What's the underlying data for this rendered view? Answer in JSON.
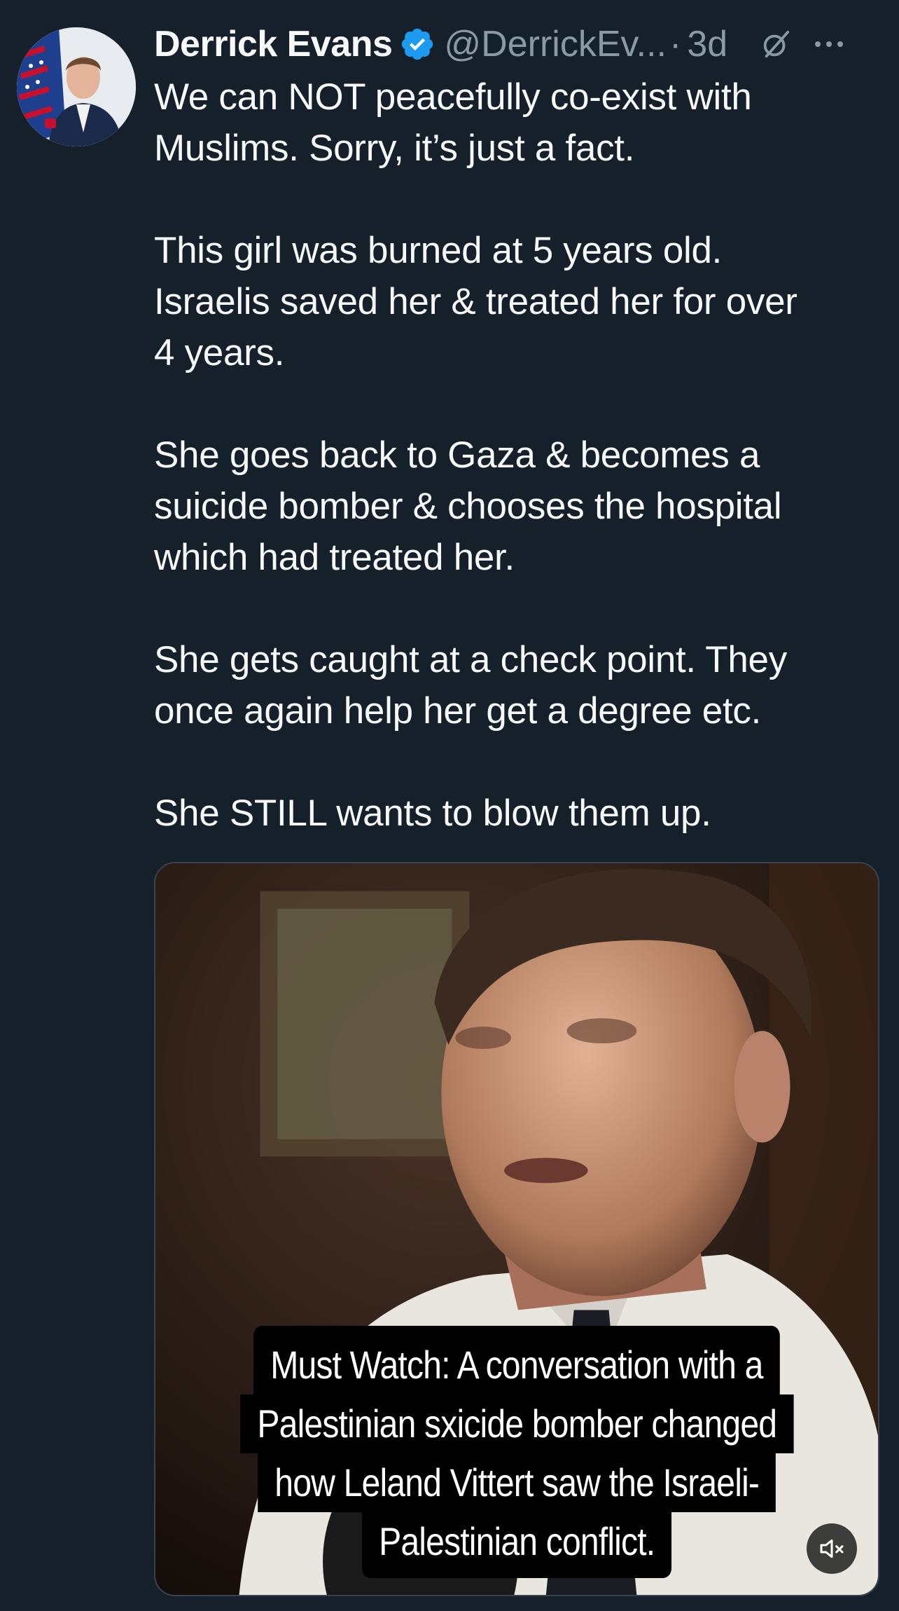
{
  "tweet": {
    "author_name": "Derrick Evans",
    "handle": "@DerrickEv...",
    "separator": "·",
    "time": "3d",
    "body": [
      "We can NOT peacefully co-exist with\nMuslims. Sorry, it’s just a fact.",
      "This girl was burned at 5 years old.\nIsraelis saved her & treated her for over\n4 years.",
      "She goes back to Gaza & becomes a\nsuicide bomber & chooses the hospital\nwhich had treated her.",
      "She gets caught at a check point. They\nonce again help her get a degree etc.",
      "She STILL wants to blow them up."
    ],
    "video_caption": [
      "Must Watch: A conversation with a",
      "Palestinian sxicide bomber changed",
      "how Leland Vittert saw the Israeli-",
      "Palestinian conflict."
    ],
    "icons": {
      "verified": "verified-badge-icon",
      "grok": "grok-icon",
      "more": "more-icon",
      "mute": "muted-speaker-icon"
    },
    "colors": {
      "background": "#15202b",
      "text": "#f7f9f9",
      "secondary": "#8b98a5",
      "verified": "#1d9bf0"
    }
  }
}
